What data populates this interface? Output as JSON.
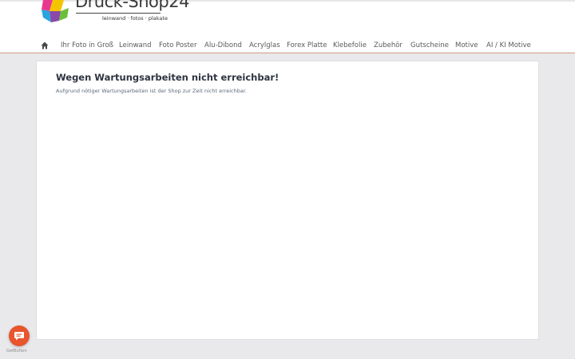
{
  "brand": {
    "name": "Druck-Shop24",
    "tagline": "leinwand · fotos · plakate",
    "colors": {
      "accent": "#e8542b",
      "nav_underline": "#e0a58c"
    }
  },
  "nav": {
    "home_icon": "home-icon",
    "items": [
      {
        "label": "Ihr Foto in Groß"
      },
      {
        "label": "Leinwand"
      },
      {
        "label": "Foto Poster"
      },
      {
        "label": "Alu-Dibond"
      },
      {
        "label": "Acrylglas"
      },
      {
        "label": "Forex Platte"
      },
      {
        "label": "Klebefolie"
      },
      {
        "label": "Zubehör"
      },
      {
        "label": "Gutscheine"
      },
      {
        "label": "Motive"
      },
      {
        "label": "AI / KI Motive"
      }
    ]
  },
  "main": {
    "title": "Wegen Wartungsarbeiten nicht erreichbar!",
    "message": "Aufgrund nötiger Wartungsarbeiten ist der Shop zur Zeit nicht erreichbar."
  },
  "chat_widget": {
    "icon": "chat-bubble-icon",
    "label": "GetButton"
  }
}
